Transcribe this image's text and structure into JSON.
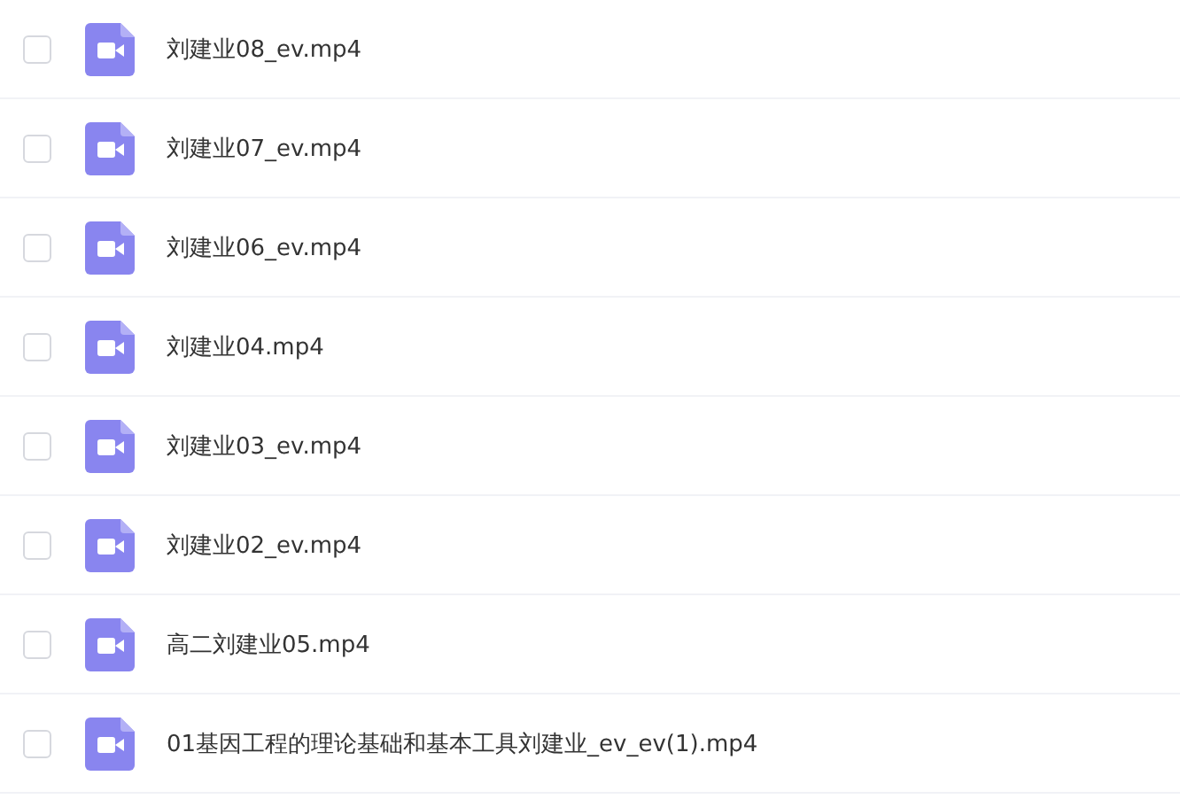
{
  "files": [
    {
      "name": "刘建业08_ev.mp4",
      "checked": false
    },
    {
      "name": "刘建业07_ev.mp4",
      "checked": false
    },
    {
      "name": "刘建业06_ev.mp4",
      "checked": false
    },
    {
      "name": "刘建业04.mp4",
      "checked": false
    },
    {
      "name": "刘建业03_ev.mp4",
      "checked": false
    },
    {
      "name": "刘建业02_ev.mp4",
      "checked": false
    },
    {
      "name": "高二刘建业05.mp4",
      "checked": false
    },
    {
      "name": "01基因工程的理论基础和基本工具刘建业_ev_ev(1).mp4",
      "checked": false
    }
  ]
}
